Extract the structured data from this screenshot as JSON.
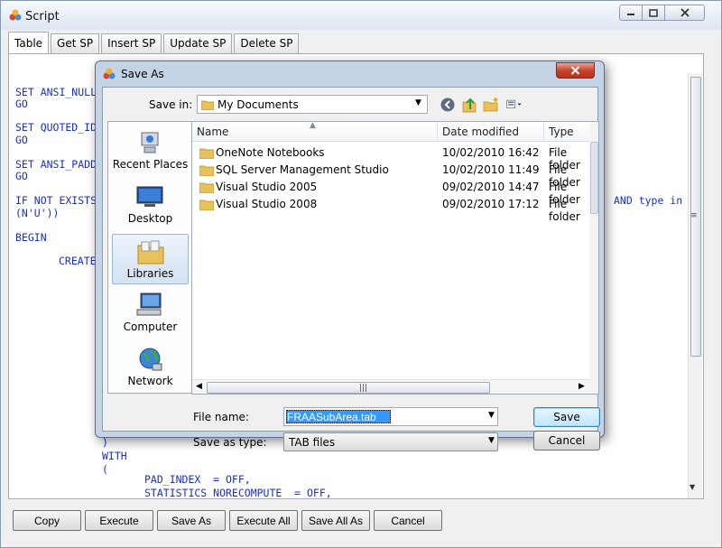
{
  "window": {
    "title": "Script",
    "tabs": [
      {
        "label": "Table",
        "active": true
      },
      {
        "label": "Get SP"
      },
      {
        "label": "Insert SP"
      },
      {
        "label": "Update SP"
      },
      {
        "label": "Delete SP"
      }
    ],
    "code_lines": [
      "SET ANSI_NULL",
      "GO",
      "SET QUOTED_ID",
      "GO",
      "SET ANSI_PADD",
      "GO",
      "IF NOT EXISTS",
      "(N'U'))",
      "BEGIN",
      "CREATE",
      "AND type in",
      ")",
      "WITH",
      "(",
      "PAD_INDEX  = OFF,",
      "STATISTICS_NORECOMPUTE  = OFF,"
    ],
    "buttons": {
      "copy": "Copy",
      "execute": "Execute",
      "save_as": "Save As",
      "execute_all": "Execute All",
      "save_all_as": "Save All As",
      "cancel": "Cancel"
    }
  },
  "dialog": {
    "title": "Save As",
    "save_in_label": "Save in:",
    "save_in_value": "My Documents",
    "places": [
      {
        "label": "Recent Places",
        "icon": "recent-places-icon"
      },
      {
        "label": "Desktop",
        "icon": "desktop-icon"
      },
      {
        "label": "Libraries",
        "icon": "libraries-icon",
        "selected": true
      },
      {
        "label": "Computer",
        "icon": "computer-icon"
      },
      {
        "label": "Network",
        "icon": "network-icon"
      }
    ],
    "columns": {
      "name": "Name",
      "date": "Date modified",
      "type": "Type"
    },
    "files": [
      {
        "name": "OneNote Notebooks",
        "date": "10/02/2010 16:42",
        "type": "File folder"
      },
      {
        "name": "SQL Server Management Studio",
        "date": "10/02/2010 11:49",
        "type": "File folder"
      },
      {
        "name": "Visual Studio 2005",
        "date": "09/02/2010 14:47",
        "type": "File folder"
      },
      {
        "name": "Visual Studio 2008",
        "date": "09/02/2010 17:12",
        "type": "File folder"
      }
    ],
    "file_name_label": "File name:",
    "file_name_value": "FRAASubArea.tab",
    "save_as_type_label": "Save as type:",
    "save_as_type_value": "TAB files",
    "save_button": "Save",
    "cancel_button": "Cancel"
  },
  "colors": {
    "code_text": "#1a2ecf",
    "selection": "#3399ff",
    "folder": "#e8c15a"
  }
}
